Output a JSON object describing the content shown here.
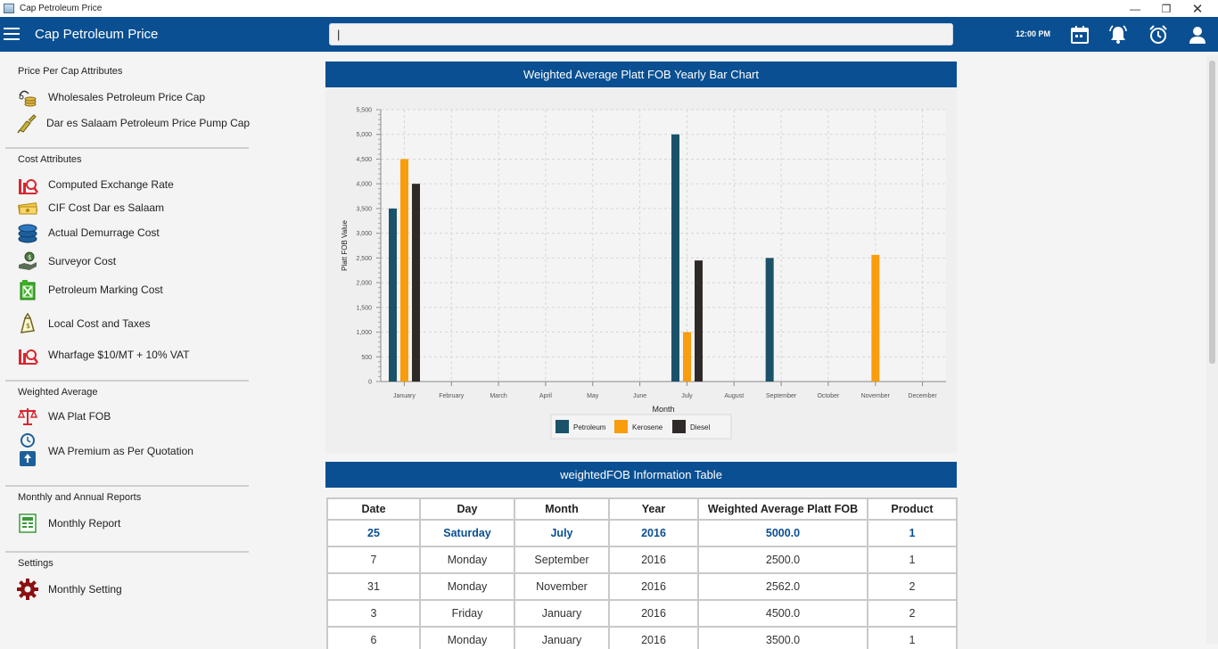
{
  "window": {
    "title": "Cap Petroleum Price"
  },
  "appbar": {
    "title": "Cap Petroleum Price",
    "search_value": "|",
    "time": "12:00 PM"
  },
  "sidebar": {
    "sections": [
      {
        "title": "Price Per Cap Attributes",
        "items": [
          {
            "label": "Wholesales Petroleum Price Cap",
            "icon": "coins-icon"
          },
          {
            "label": "Dar es Salaam Petroleum Price Pump Cap",
            "icon": "fuel-nozzle-icon"
          }
        ]
      },
      {
        "title": "Cost Attributes",
        "items": [
          {
            "label": "Computed Exchange Rate",
            "icon": "exchange-chart-icon"
          },
          {
            "label": "CIF Cost Dar es Salaam",
            "icon": "cash-icon"
          },
          {
            "label": "Actual Demurrage Cost",
            "icon": "coin-stack-icon"
          },
          {
            "label": "Surveyor Cost",
            "icon": "money-hand-icon"
          },
          {
            "label": "Petroleum Marking Cost",
            "icon": "fuel-can-icon"
          },
          {
            "label": "Local Cost and Taxes",
            "icon": "money-bag-icon"
          },
          {
            "label": "Wharfage $10/MT + 10% VAT",
            "icon": "exchange-chart-icon"
          }
        ]
      },
      {
        "title": "Weighted Average",
        "items": [
          {
            "label": "WA Plat FOB",
            "icon": "scale-icon"
          },
          {
            "label": "WA Premium as Per Quotation",
            "icon": "clock-upload-icon"
          }
        ]
      },
      {
        "title": "Monthly and Annual Reports",
        "items": [
          {
            "label": "Monthly Report",
            "icon": "report-icon"
          }
        ]
      },
      {
        "title": "Settings",
        "items": [
          {
            "label": "Monthly Setting",
            "icon": "gear-icon"
          }
        ]
      }
    ]
  },
  "chart_panel": {
    "title": "Weighted Average Platt FOB Yearly Bar Chart"
  },
  "chart_data": {
    "type": "bar",
    "title": "",
    "xlabel": "Month",
    "ylabel": "Platt FOB Value",
    "ylim": [
      0,
      5500
    ],
    "yticks": [
      "0",
      "500",
      "1,000",
      "1,500",
      "2,000",
      "2,500",
      "3,000",
      "3,500",
      "4,000",
      "4,500",
      "5,000",
      "5,500"
    ],
    "categories": [
      "January",
      "February",
      "March",
      "April",
      "May",
      "June",
      "July",
      "August",
      "September",
      "October",
      "November",
      "December"
    ],
    "series": [
      {
        "name": "Petroleum",
        "color": "#1a5269",
        "values": [
          3500,
          null,
          null,
          null,
          null,
          null,
          5000,
          null,
          2500,
          null,
          null,
          null
        ]
      },
      {
        "name": "Kerosene",
        "color": "#f99d0c",
        "values": [
          4500,
          null,
          null,
          null,
          null,
          null,
          1000,
          null,
          null,
          null,
          2562,
          null
        ]
      },
      {
        "name": "Diesel",
        "color": "#2f2a28",
        "values": [
          4000,
          null,
          null,
          null,
          null,
          null,
          2450,
          null,
          null,
          null,
          null,
          null
        ]
      }
    ],
    "grid": true,
    "legend": "bottom"
  },
  "table_panel": {
    "title": "weightedFOB Information Table"
  },
  "table": {
    "columns": [
      "Date",
      "Day",
      "Month",
      "Year",
      "Weighted Average Platt FOB",
      "Product"
    ],
    "rows": [
      [
        "25",
        "Saturday",
        "July",
        "2016",
        "5000.0",
        "1"
      ],
      [
        "7",
        "Monday",
        "September",
        "2016",
        "2500.0",
        "1"
      ],
      [
        "31",
        "Monday",
        "November",
        "2016",
        "2562.0",
        "2"
      ],
      [
        "3",
        "Friday",
        "January",
        "2016",
        "4500.0",
        "2"
      ],
      [
        "6",
        "Monday",
        "January",
        "2016",
        "3500.0",
        "1"
      ]
    ]
  },
  "colors": {
    "appbar": "#0a4f91",
    "accent": "#0a4f91"
  }
}
